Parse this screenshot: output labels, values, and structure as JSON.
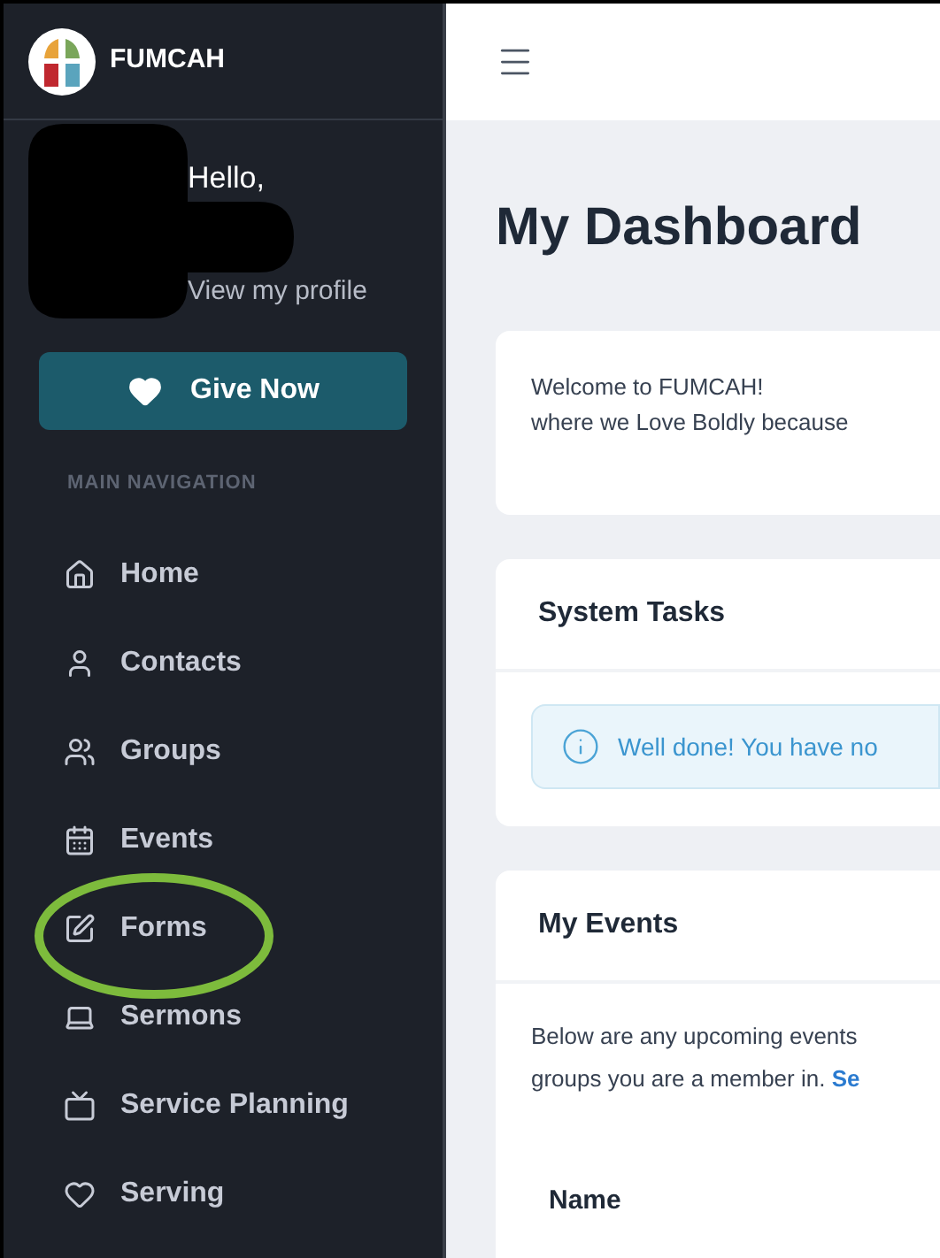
{
  "brand": {
    "name": "FUMCAH"
  },
  "profile": {
    "greeting": "Hello,",
    "link": "View my profile"
  },
  "give_button": {
    "label": "Give Now"
  },
  "nav": {
    "heading": "MAIN NAVIGATION",
    "items": [
      {
        "label": "Home"
      },
      {
        "label": "Contacts"
      },
      {
        "label": "Groups"
      },
      {
        "label": "Events"
      },
      {
        "label": "Forms"
      },
      {
        "label": "Sermons"
      },
      {
        "label": "Service Planning"
      },
      {
        "label": "Serving"
      }
    ]
  },
  "page_title": "My Dashboard",
  "welcome_card": {
    "lines": [
      "Welcome to FUMCAH!",
      "where we Love Boldly because"
    ]
  },
  "system_tasks": {
    "title": "System Tasks",
    "alert": "Well done! You have no"
  },
  "my_events": {
    "title": "My Events",
    "line_1": "Below are any upcoming events",
    "line_2": "groups you are a member in.",
    "link": "Se",
    "column_1": "Name"
  }
}
